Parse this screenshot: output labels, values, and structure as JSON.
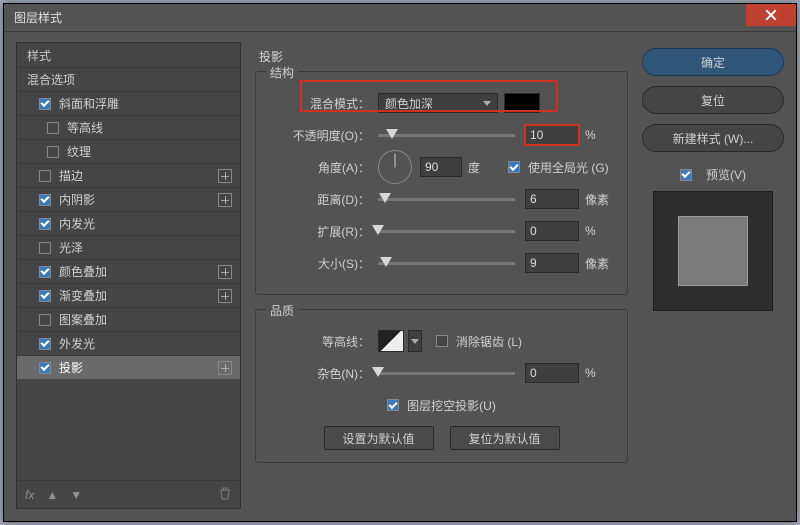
{
  "window": {
    "title": "图层样式"
  },
  "sidebar": {
    "header": "样式",
    "blending": "混合选项",
    "items": [
      {
        "label": "斜面和浮雕",
        "checked": true,
        "plus": false
      },
      {
        "label": "等高线",
        "checked": false,
        "plus": false,
        "sub": true
      },
      {
        "label": "纹理",
        "checked": false,
        "plus": false,
        "sub": true
      },
      {
        "label": "描边",
        "checked": false,
        "plus": true
      },
      {
        "label": "内阴影",
        "checked": true,
        "plus": true
      },
      {
        "label": "内发光",
        "checked": true,
        "plus": false
      },
      {
        "label": "光泽",
        "checked": false,
        "plus": false
      },
      {
        "label": "颜色叠加",
        "checked": true,
        "plus": true
      },
      {
        "label": "渐变叠加",
        "checked": true,
        "plus": true
      },
      {
        "label": "图案叠加",
        "checked": false,
        "plus": false
      },
      {
        "label": "外发光",
        "checked": true,
        "plus": false
      },
      {
        "label": "投影",
        "checked": true,
        "plus": true,
        "selected": true
      }
    ]
  },
  "effect": {
    "title": "投影",
    "group_structure": "结构",
    "group_quality": "品质",
    "blend_mode_label": "混合模式：",
    "blend_mode_value": "颜色加深",
    "swatch_color": "#000000",
    "opacity_label": "不透明度(O)：",
    "opacity_value": "10",
    "angle_label": "角度(A)：",
    "angle_value": "90",
    "angle_unit": "度",
    "global_light": "使用全局光 (G)",
    "global_light_checked": true,
    "distance_label": "距离(D)：",
    "distance_value": "6",
    "spread_label": "扩展(R)：",
    "spread_value": "0",
    "size_label": "大小(S)：",
    "size_value": "9",
    "px": "像素",
    "pct": "%",
    "contour_label": "等高线：",
    "antialias": "消除锯齿 (L)",
    "antialias_checked": false,
    "noise_label": "杂色(N)：",
    "noise_value": "0",
    "knockout": "图层挖空投影(U)",
    "knockout_checked": true,
    "btn_default": "设置为默认值",
    "btn_reset": "复位为默认值"
  },
  "right": {
    "ok": "确定",
    "cancel": "复位",
    "newstyle": "新建样式 (W)...",
    "preview": "预览(V)",
    "preview_checked": true
  }
}
